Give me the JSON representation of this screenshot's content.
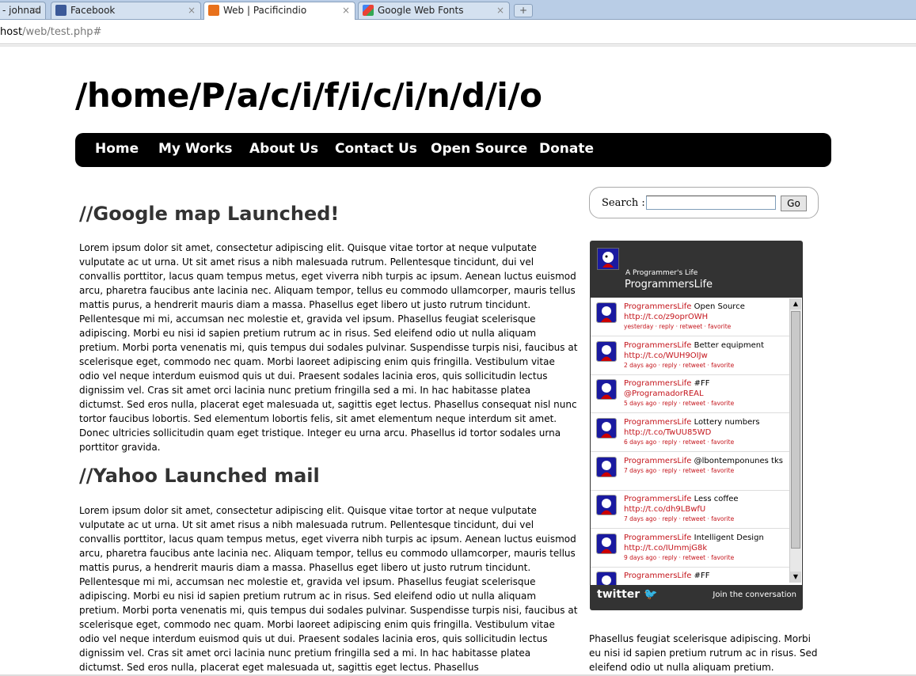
{
  "browser": {
    "tabs": [
      {
        "label": "- johnad",
        "close": "×"
      },
      {
        "label": "Facebook",
        "close": "×"
      },
      {
        "label": "Web | Pacificindio",
        "close": "×"
      },
      {
        "label": "Google Web Fonts",
        "close": "×"
      }
    ],
    "new_tab": "+",
    "url_prefix": "host",
    "url_rest": "/web/test.php#"
  },
  "site": {
    "title": "/home/P/a/c/i/f/i/c/i/n/d/i/o",
    "nav": [
      "Home",
      "My Works",
      "About Us",
      "Contact Us",
      "Open Source",
      "Donate"
    ]
  },
  "posts": [
    {
      "title": "//Google map Launched!",
      "body": "Lorem ipsum dolor sit amet, consectetur adipiscing elit. Quisque vitae tortor at neque vulputate vulputate ac ut urna. Ut sit amet risus a nibh malesuada rutrum. Pellentesque tincidunt, dui vel convallis porttitor, lacus quam tempus metus, eget viverra nibh turpis ac ipsum. Aenean luctus euismod arcu, pharetra faucibus ante lacinia nec. Aliquam tempor, tellus eu commodo ullamcorper, mauris tellus mattis purus, a hendrerit mauris diam a massa. Phasellus eget libero ut justo rutrum tincidunt. Pellentesque mi mi, accumsan nec molestie et, gravida vel ipsum. Phasellus feugiat scelerisque adipiscing. Morbi eu nisi id sapien pretium rutrum ac in risus. Sed eleifend odio ut nulla aliquam pretium. Morbi porta venenatis mi, quis tempus dui sodales pulvinar. Suspendisse turpis nisi, faucibus at scelerisque eget, commodo nec quam. Morbi laoreet adipiscing enim quis fringilla. Vestibulum vitae odio vel neque interdum euismod quis ut dui. Praesent sodales lacinia eros, quis sollicitudin lectus dignissim vel. Cras sit amet orci lacinia nunc pretium fringilla sed a mi. In hac habitasse platea dictumst. Sed eros nulla, placerat eget malesuada ut, sagittis eget lectus. Phasellus consequat nisl nunc tortor faucibus lobortis. Sed elementum lobortis felis, sit amet elementum neque interdum sit amet. Donec ultricies sollicitudin quam eget tristique. Integer eu urna arcu. Phasellus id tortor sodales urna porttitor gravida."
    },
    {
      "title": "//Yahoo Launched mail",
      "body": "Lorem ipsum dolor sit amet, consectetur adipiscing elit. Quisque vitae tortor at neque vulputate vulputate ac ut urna. Ut sit amet risus a nibh malesuada rutrum. Pellentesque tincidunt, dui vel convallis porttitor, lacus quam tempus metus, eget viverra nibh turpis ac ipsum. Aenean luctus euismod arcu, pharetra faucibus ante lacinia nec. Aliquam tempor, tellus eu commodo ullamcorper, mauris tellus mattis purus, a hendrerit mauris diam a massa. Phasellus eget libero ut justo rutrum tincidunt. Pellentesque mi mi, accumsan nec molestie et, gravida vel ipsum. Phasellus feugiat scelerisque adipiscing. Morbi eu nisi id sapien pretium rutrum ac in risus. Sed eleifend odio ut nulla aliquam pretium. Morbi porta venenatis mi, quis tempus dui sodales pulvinar. Suspendisse turpis nisi, faucibus at scelerisque eget, commodo nec quam. Morbi laoreet adipiscing enim quis fringilla. Vestibulum vitae odio vel neque interdum euismod quis ut dui. Praesent sodales lacinia eros, quis sollicitudin lectus dignissim vel. Cras sit amet orci lacinia nunc pretium fringilla sed a mi. In hac habitasse platea dictumst. Sed eros nulla, placerat eget malesuada ut, sagittis eget lectus. Phasellus"
    }
  ],
  "search": {
    "label": "Search :",
    "value": "",
    "button": "Go"
  },
  "twitter": {
    "subtitle": "A Programmer's Life",
    "name": "ProgrammersLife",
    "tweets": [
      {
        "user": "ProgrammersLife",
        "text": " Open Source",
        "link": "http://t.co/z9oprOWH",
        "meta": "yesterday · reply · retweet · favorite"
      },
      {
        "user": "ProgrammersLife",
        "text": " Better equipment",
        "link": "http://t.co/WUH9OIJw",
        "meta": "2 days ago · reply · retweet · favorite"
      },
      {
        "user": "ProgrammersLife",
        "text": " #FF",
        "link": "@ProgramadorREAL",
        "meta": "5 days ago · reply · retweet · favorite"
      },
      {
        "user": "ProgrammersLife",
        "text": " Lottery numbers",
        "link": "http://t.co/TwUU85WD",
        "meta": "6 days ago · reply · retweet · favorite"
      },
      {
        "user": "ProgrammersLife",
        "text": " @lbontemponunes tks",
        "link": "",
        "meta": "7 days ago · reply · retweet · favorite"
      },
      {
        "user": "ProgrammersLife",
        "text": " Less coffee",
        "link": "http://t.co/dh9LBwfU",
        "meta": "7 days ago · reply · retweet · favorite"
      },
      {
        "user": "ProgrammersLife",
        "text": " Intelligent Design",
        "link": "http://t.co/IUmmjG8k",
        "meta": "9 days ago · reply · retweet · favorite"
      },
      {
        "user": "ProgrammersLife",
        "text": " #FF",
        "link": "",
        "meta": ""
      }
    ],
    "footer_logo": "twitter",
    "join": "Join the conversation"
  },
  "sidebar_text": "Phasellus feugiat scelerisque adipiscing. Morbi eu nisi id sapien pretium rutrum ac in risus. Sed eleifend odio ut nulla aliquam pretium.",
  "colors": {
    "nav_bg": "#000000",
    "tweet_accent": "#c4151c",
    "widget_bg": "#333333"
  }
}
